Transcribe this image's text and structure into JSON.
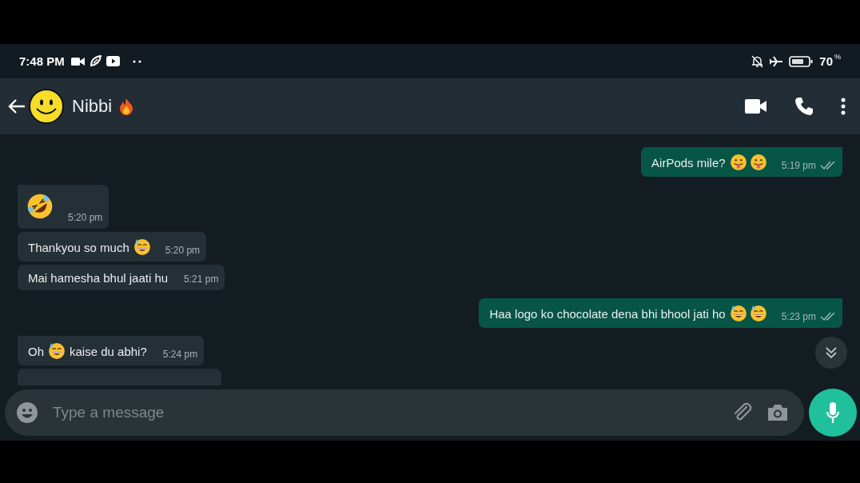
{
  "status_bar": {
    "time": "7:48 PM",
    "battery": "70",
    "battery_unit": "%"
  },
  "header": {
    "name": "Nibbi"
  },
  "messages": [
    {
      "kind": "out",
      "tail": true,
      "parts": [
        {
          "kind": "text",
          "text": "AirPods mile?"
        },
        {
          "kind": "tongue"
        },
        {
          "kind": "tongue"
        }
      ],
      "time": "5:19 pm",
      "ticks": true
    },
    {
      "kind": "in",
      "tail": true,
      "parts": [
        {
          "kind": "rofl"
        }
      ],
      "time": "5:20 pm",
      "big": true
    },
    {
      "kind": "in",
      "tail": false,
      "parts": [
        {
          "kind": "text",
          "text": "Thankyou so much"
        },
        {
          "kind": "sweat"
        }
      ],
      "time": "5:20 pm"
    },
    {
      "kind": "in",
      "tail": false,
      "parts": [
        {
          "kind": "text",
          "text": "Mai hamesha bhul jaati hu"
        }
      ],
      "time": "5:21 pm"
    },
    {
      "kind": "out",
      "tail": true,
      "parts": [
        {
          "kind": "text",
          "text": "Haa logo ko chocolate dena bhi bhool jati ho"
        },
        {
          "kind": "sweat"
        },
        {
          "kind": "sweat"
        }
      ],
      "time": "5:23 pm",
      "ticks": true
    },
    {
      "kind": "in",
      "tail": true,
      "parts": [
        {
          "kind": "text",
          "text": "Oh"
        },
        {
          "kind": "sweat"
        },
        {
          "kind": "text",
          "text": "kaise du abhi?"
        }
      ],
      "time": "5:24 pm"
    },
    {
      "kind": "cut"
    }
  ],
  "composer": {
    "placeholder": "Type a message"
  }
}
